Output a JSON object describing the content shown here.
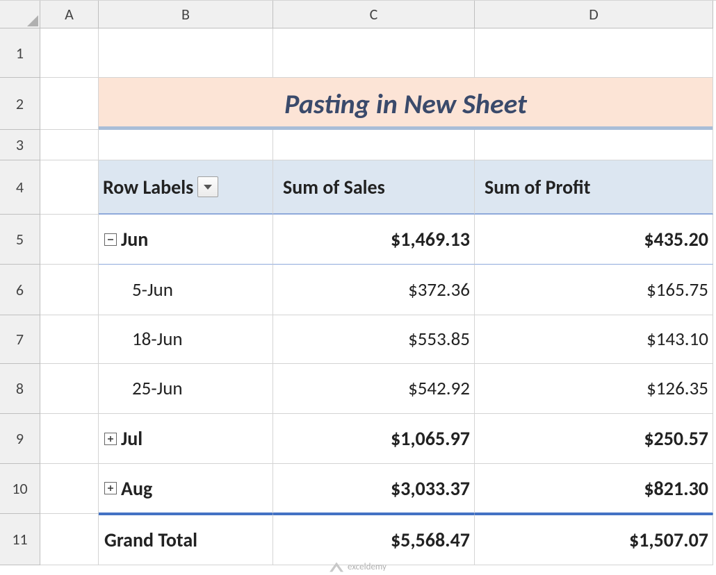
{
  "columns": [
    "A",
    "B",
    "C",
    "D"
  ],
  "rows": [
    "1",
    "2",
    "3",
    "4",
    "5",
    "6",
    "7",
    "8",
    "9",
    "10",
    "11"
  ],
  "title": "Pasting in New Sheet",
  "pivot": {
    "headers": {
      "row_labels": "Row Labels",
      "sum_sales": "Sum of Sales",
      "sum_profit": "Sum of Profit"
    },
    "groups": [
      {
        "name": "Jun",
        "expanded": true,
        "sales": "$1,469.13",
        "profit": "$435.20",
        "details": [
          {
            "label": "5-Jun",
            "sales": "$372.36",
            "profit": "$165.75"
          },
          {
            "label": "18-Jun",
            "sales": "$553.85",
            "profit": "$143.10"
          },
          {
            "label": "25-Jun",
            "sales": "$542.92",
            "profit": "$126.35"
          }
        ]
      },
      {
        "name": "Jul",
        "expanded": false,
        "sales": "$1,065.97",
        "profit": "$250.57"
      },
      {
        "name": "Aug",
        "expanded": false,
        "sales": "$3,033.37",
        "profit": "$821.30"
      }
    ],
    "grand_total": {
      "label": "Grand Total",
      "sales": "$5,568.47",
      "profit": "$1,507.07"
    }
  },
  "icons": {
    "collapse": "⊟",
    "expand": "⊞"
  },
  "watermark": "exceldemy"
}
